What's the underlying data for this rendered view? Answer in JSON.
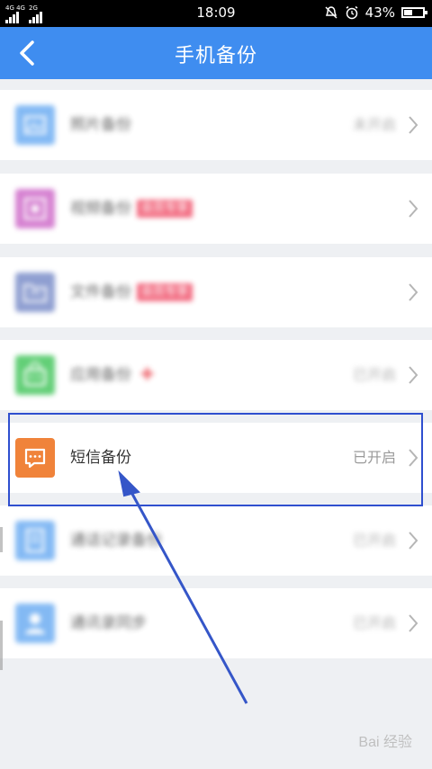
{
  "status": {
    "network_top": "4G 4G",
    "network_bottom": "2G",
    "time": "18:09",
    "battery_text": "43%",
    "battery_level": 0.43
  },
  "header": {
    "back_icon": "chevron-left-icon",
    "title": "手机备份"
  },
  "rows": [
    {
      "name": "photo-backup",
      "label": "照片备份",
      "state": "未开启",
      "icon": "image-icon",
      "color": "#5aa2f0",
      "blurred": true
    },
    {
      "name": "video-backup",
      "label": "视频备份",
      "tag": "会员专享",
      "icon": "film-icon",
      "color": "#c858c2",
      "blurred": true
    },
    {
      "name": "file-backup",
      "label": "文件备份",
      "tag": "会员专享",
      "icon": "folder-sync-icon",
      "color": "#6a7fc2",
      "blurred": true
    },
    {
      "name": "app-backup",
      "label": "应用备份",
      "state": "已开启",
      "icon": "shopping-bag-icon",
      "color": "#2fbf4a",
      "blurred": true
    },
    {
      "name": "sms-backup",
      "label": "短信备份",
      "state": "已开启",
      "icon": "message-icon",
      "color": "#f0833a",
      "blurred": false
    },
    {
      "name": "call-log-backup",
      "label": "通话记录备份",
      "state": "已开启",
      "icon": "phone-log-icon",
      "color": "#5aa2f0",
      "blurred": true
    },
    {
      "name": "contacts-backup",
      "label": "通讯录同步",
      "state": "已开启",
      "icon": "contact-icon",
      "color": "#5aa2f0",
      "blurred": true
    }
  ],
  "watermark": "Bai 经验",
  "colors": {
    "header": "#3f8df0",
    "highlight": "#2f4fcf",
    "arrow": "#3556c8",
    "tag": "#ee3e5a"
  }
}
